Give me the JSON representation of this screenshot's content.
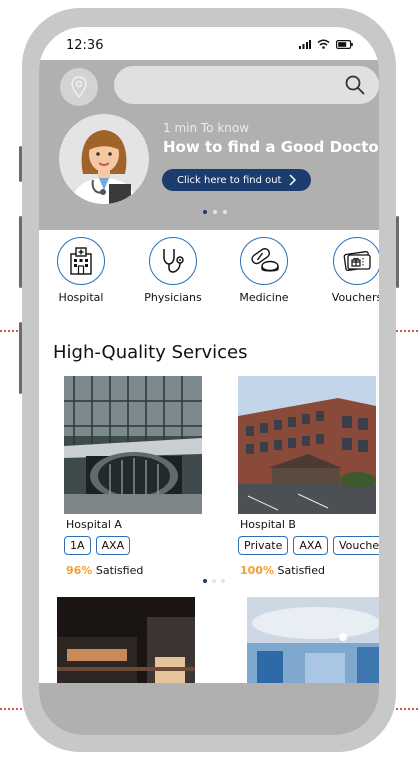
{
  "status": {
    "time": "12:36"
  },
  "search": {
    "placeholder": ""
  },
  "banner": {
    "small_text": "1 min To know",
    "headline": "How to find a Good Doctor",
    "cta_label": "Click here to find out"
  },
  "categories": [
    {
      "label": "Hospital"
    },
    {
      "label": "Physicians"
    },
    {
      "label": "Medicine"
    },
    {
      "label": "Vouchers"
    }
  ],
  "section": {
    "title": "High-Quality Services"
  },
  "hospitals": [
    {
      "name": "Hospital A",
      "tags": [
        "1A",
        "AXA"
      ],
      "satisfied_pct": "96%",
      "satisfied_label": "Satisfied"
    },
    {
      "name": "Hospital B",
      "tags": [
        "Private",
        "AXA",
        "Voucher"
      ],
      "satisfied_pct": "100%",
      "satisfied_label": "Satisfied"
    }
  ],
  "colors": {
    "accent": "#1c3c6e",
    "border": "#2a6fb6",
    "highlight": "#f0a030",
    "banner_bg": "#b0b0b0"
  }
}
